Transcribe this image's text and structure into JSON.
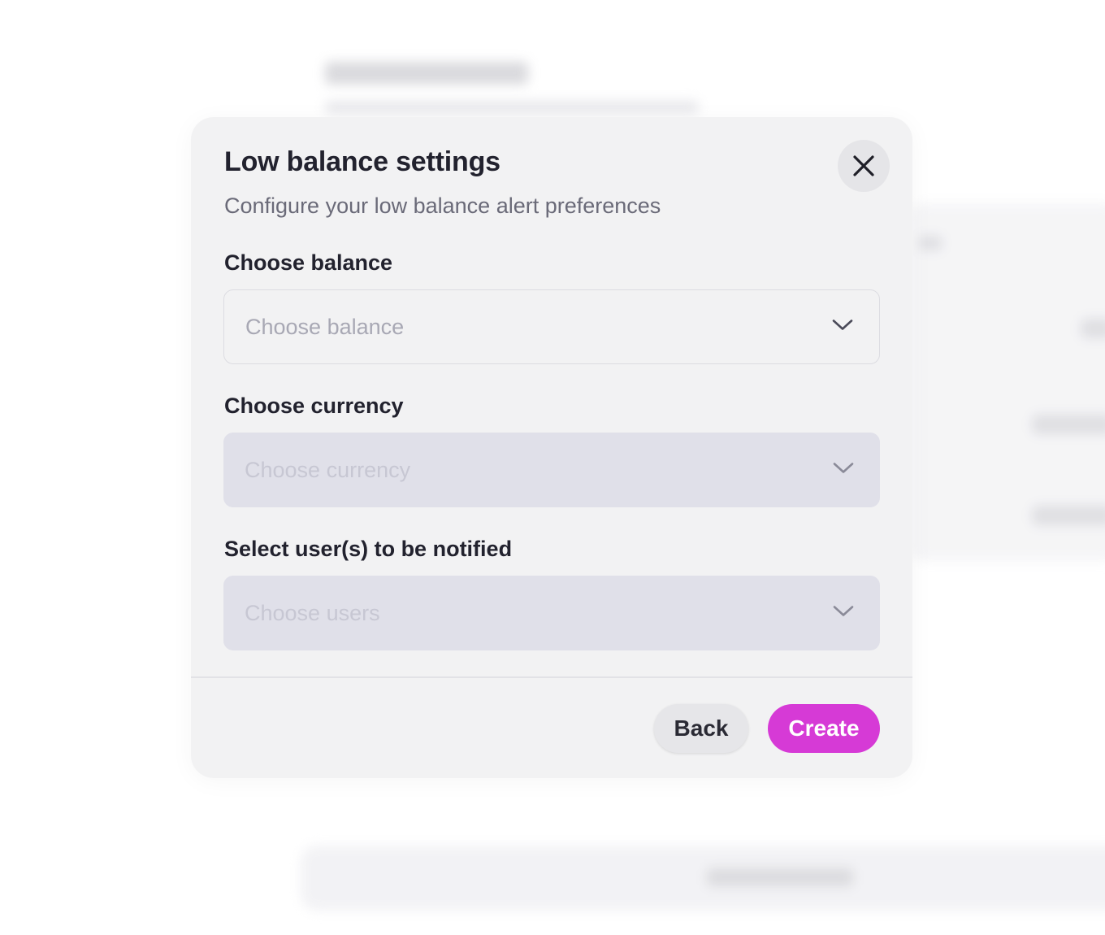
{
  "modal": {
    "title": "Low balance settings",
    "subtitle": "Configure your low balance alert preferences",
    "close_icon": "close-icon"
  },
  "fields": [
    {
      "label": "Choose balance",
      "placeholder": "Choose balance",
      "disabled": false
    },
    {
      "label": "Choose currency",
      "placeholder": "Choose currency",
      "disabled": true
    },
    {
      "label": "Select user(s) to be notified",
      "placeholder": "Choose users",
      "disabled": true
    }
  ],
  "footer": {
    "back_label": "Back",
    "create_label": "Create"
  },
  "colors": {
    "accent": "#d63ad6",
    "modal_bg": "#f2f2f3",
    "disabled_field_bg": "#e0e0e9",
    "title_text": "#22222e"
  }
}
